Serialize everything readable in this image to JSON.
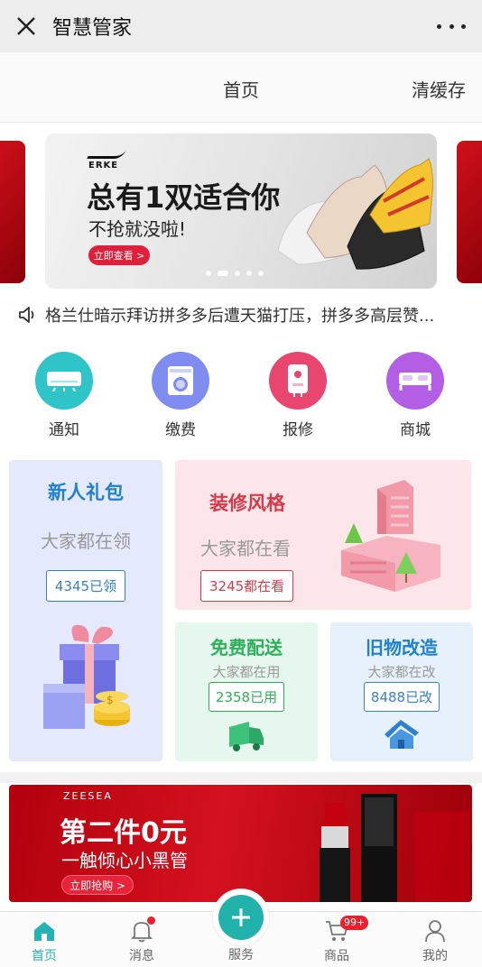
{
  "window": {
    "title": "智慧管家",
    "close_icon": "close-icon",
    "more_icon": "more-dots-icon"
  },
  "header": {
    "home_label": "首页",
    "clear_cache_label": "清缓存"
  },
  "banner": {
    "brand": "ERKE",
    "headline": "总有1双适合你",
    "subline": "不抢就没啦!",
    "button_label": "立即查看 >",
    "slide_count": 5,
    "active_slide": 2
  },
  "notice": {
    "icon": "speaker-icon",
    "text": "格兰仕暗示拜访拼多多后遭天猫打压，拼多多高层赞..."
  },
  "quick_entries": [
    {
      "label": "通知",
      "icon": "air-conditioner-icon",
      "color": "#2ec4c8"
    },
    {
      "label": "缴费",
      "icon": "washing-machine-icon",
      "color": "#7f8df0"
    },
    {
      "label": "报修",
      "icon": "water-heater-icon",
      "color": "#e8466e"
    },
    {
      "label": "商城",
      "icon": "bed-icon",
      "color": "#b25fe6"
    }
  ],
  "cards": {
    "new_gift": {
      "title": "新人礼包",
      "subtitle": "大家都在领",
      "badge": "4345已领"
    },
    "decoration": {
      "title": "装修风格",
      "subtitle": "大家都在看",
      "badge": "3245都在看"
    },
    "free_delivery": {
      "title": "免费配送",
      "subtitle": "大家都在用",
      "badge": "2358已用"
    },
    "renovation": {
      "title": "旧物改造",
      "subtitle": "大家都在改",
      "badge": "8488已改"
    }
  },
  "promo": {
    "brand": "ZEESEA",
    "headline": "第二件0元",
    "subline": "一触倾心小黑管",
    "button_label": "立即抢购 >"
  },
  "tabbar": {
    "home": "首页",
    "messages": "消息",
    "service": "服务",
    "goods": "商品",
    "goods_badge": "99+",
    "mine": "我的"
  },
  "colors": {
    "accent": "#26b3b3",
    "badge_red": "#f01e2c"
  }
}
